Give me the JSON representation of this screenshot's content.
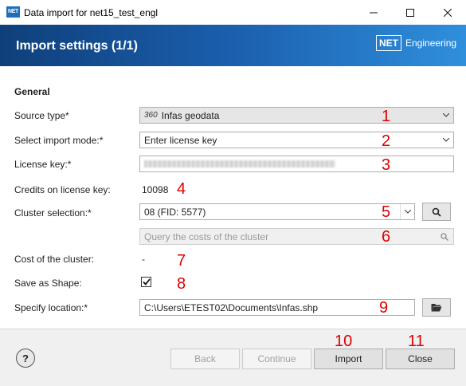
{
  "window": {
    "app_icon_text": "NET",
    "title": "Data import for net15_test_engl"
  },
  "header": {
    "title": "Import settings (1/1)",
    "logo_box": "NET",
    "logo_text": "Engineering"
  },
  "form": {
    "section_title": "General",
    "source_type": {
      "label": "Source type*",
      "value": "Infas geodata",
      "icon_text": "360"
    },
    "import_mode": {
      "label": "Select import mode:*",
      "value": "Enter license key"
    },
    "license_key": {
      "label": "License key:*"
    },
    "credits": {
      "label": "Credits on license key:",
      "value": "10098"
    },
    "cluster": {
      "label": "Cluster selection:*",
      "value": "08 (FID: 5577)"
    },
    "cluster_query": {
      "placeholder": "Query the costs of the cluster"
    },
    "cost": {
      "label": "Cost of the cluster:",
      "value": "-"
    },
    "save_as_shape": {
      "label": "Save as Shape:",
      "checked": true
    },
    "location": {
      "label": "Specify location:*",
      "value": "C:\\Users\\ETEST02\\Documents\\Infas.shp"
    }
  },
  "annotations": [
    "1",
    "2",
    "3",
    "4",
    "5",
    "6",
    "7",
    "8",
    "9",
    "10",
    "11"
  ],
  "footer": {
    "help_label": "?",
    "back_label": "Back",
    "continue_label": "Continue",
    "import_label": "Import",
    "close_label": "Close"
  },
  "colors": {
    "header_start": "#0f3f7a",
    "header_end": "#2f8fdc",
    "annotation": "#dd0000"
  }
}
